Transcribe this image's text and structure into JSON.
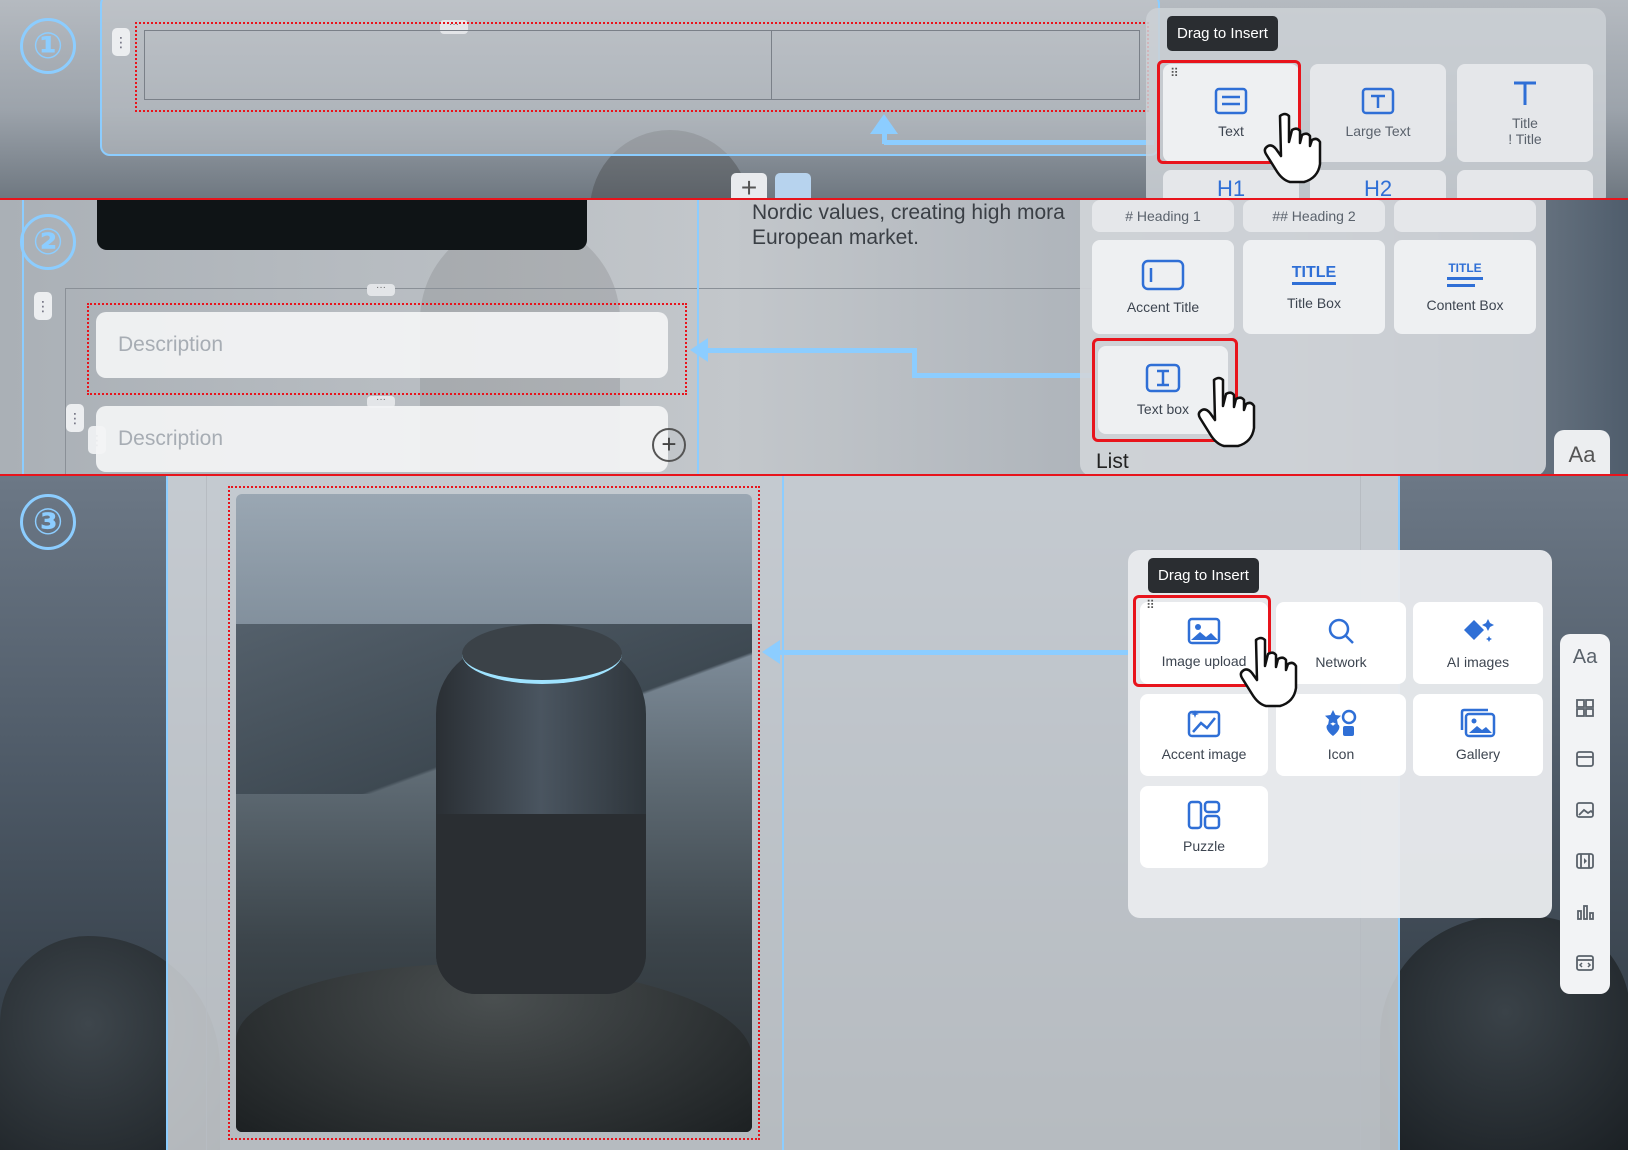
{
  "steps": [
    "①",
    "②",
    "③"
  ],
  "tooltip": "Drag to Insert",
  "panel1": {
    "items": [
      {
        "label": "Text",
        "icon": "text-lines-icon"
      },
      {
        "label": "Large Text",
        "icon": "large-text-icon"
      },
      {
        "label": "Title\n! Title",
        "icon": "title-t-icon"
      }
    ],
    "partial_row": [
      "H1",
      "H2"
    ]
  },
  "panel2": {
    "top_row": [
      "# Heading 1",
      "## Heading 2"
    ],
    "items": [
      {
        "label": "Accent Title",
        "icon": "accent-title-icon"
      },
      {
        "label": "Title Box",
        "icon": "title-box-icon",
        "glyph": "TITLE"
      },
      {
        "label": "Content Box",
        "icon": "content-box-icon",
        "glyph": "TITLE"
      },
      {
        "label": "Text box",
        "icon": "text-box-icon"
      }
    ],
    "section_label": "List",
    "font_button": "Aa"
  },
  "canvas2": {
    "body_text_line1": "Nordic values, creating high mora",
    "body_text_line2": "European market.",
    "description_placeholder": "Description",
    "description_placeholder_2": "Description"
  },
  "panel3": {
    "items": [
      {
        "label": "Image upload",
        "icon": "image-upload-icon"
      },
      {
        "label": "Network",
        "icon": "search-icon"
      },
      {
        "label": "AI images",
        "icon": "ai-sparkle-icon"
      },
      {
        "label": "Accent image",
        "icon": "accent-image-icon"
      },
      {
        "label": "Icon",
        "icon": "icon-shapes-icon"
      },
      {
        "label": "Gallery",
        "icon": "gallery-icon"
      },
      {
        "label": "Puzzle",
        "icon": "puzzle-icon"
      }
    ]
  },
  "sidebar": {
    "items": [
      {
        "label": "Aa",
        "icon": "font-icon"
      },
      {
        "icon": "layout-grid-icon"
      },
      {
        "icon": "card-icon"
      },
      {
        "icon": "image-icon"
      },
      {
        "icon": "video-icon"
      },
      {
        "icon": "chart-icon"
      },
      {
        "icon": "code-embed-icon"
      }
    ]
  },
  "colors": {
    "accent_blue": "#2f6fd6",
    "highlight_red": "#e8141c",
    "guide_blue": "#8ccdff",
    "tooltip_bg": "#2a2d31"
  }
}
